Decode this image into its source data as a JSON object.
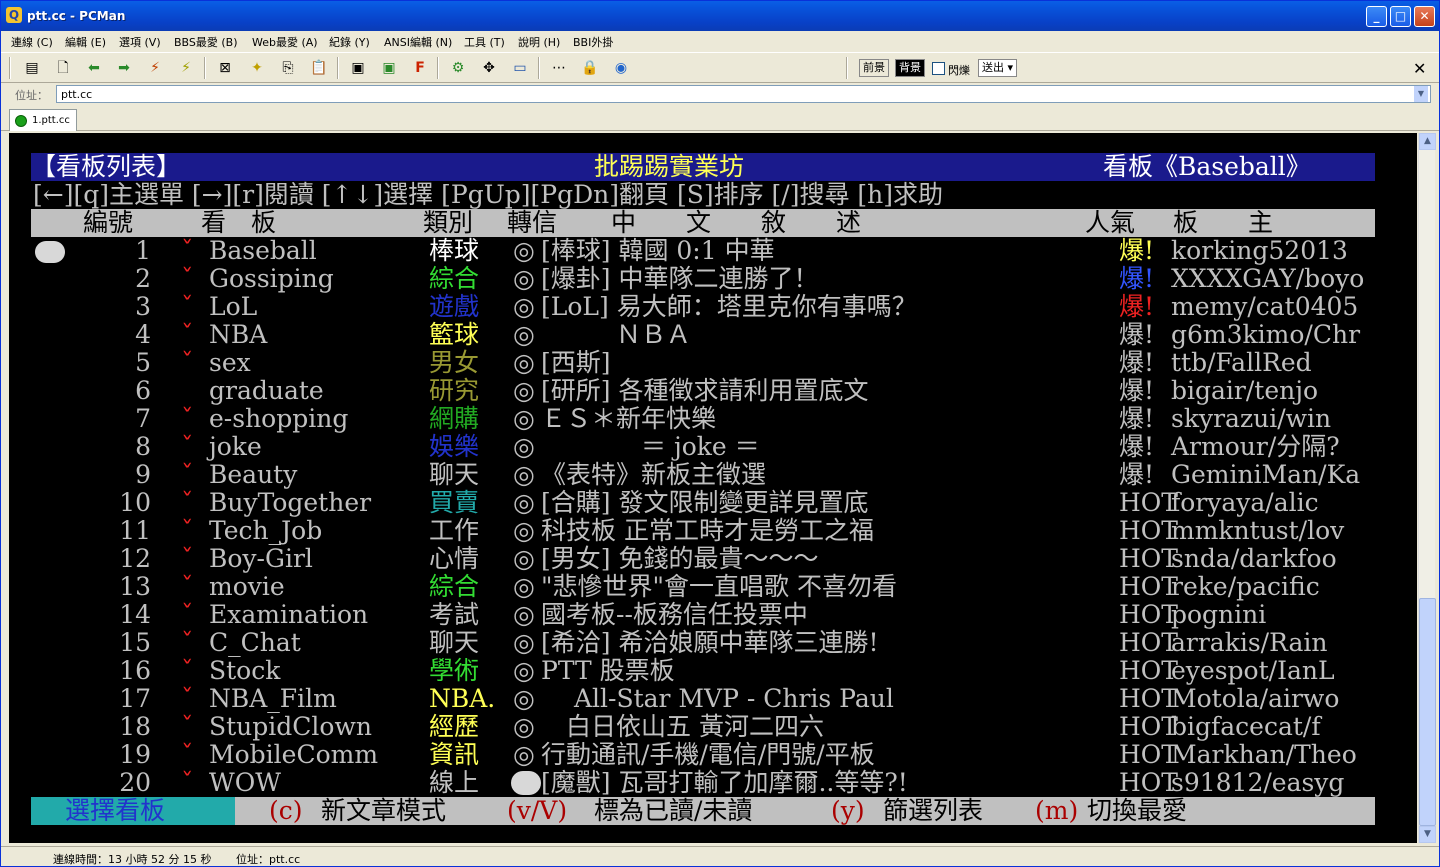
{
  "window": {
    "title": "ptt.cc - PCMan"
  },
  "menu": [
    "連線 (C)",
    "編輯 (E)",
    "選項 (V)",
    "BBS最愛 (B)",
    "Web最愛 (A)",
    "紀錄 (Y)",
    "ANSI編輯 (N)",
    "工具 (T)",
    "說明 (H)",
    "BBI外掛"
  ],
  "toolbar": {
    "fg_label": "前景",
    "bg_label": "背景",
    "blink_label": "閃爍",
    "send_label": "送出"
  },
  "address": {
    "label": "位址：",
    "value": "ptt.cc"
  },
  "tab": {
    "label": "1.ptt.cc"
  },
  "terminal": {
    "header": {
      "left": "【看板列表】",
      "center": "批踢踢實業坊",
      "right": "看板《Baseball》"
    },
    "help": "[←][q]主選單 [→][r]閱讀 [↑↓]選擇 [PgUp][PgDn]翻頁 [S]排序 [/]搜尋 [h]求助",
    "cols": {
      "num": "編號",
      "board": "看　板",
      "cat": "類別",
      "zhuan": "轉信",
      "desc": "中　　文　　敘　　述",
      "pop": "人氣",
      "mod": "板　　主"
    },
    "rows": [
      {
        "num": "1",
        "mark": "ˇ",
        "board": "Baseball",
        "cat": "棒球",
        "cat_color": "#ffffff",
        "zhuan": "◎",
        "desc": "[棒球] 韓國 0:1 中華",
        "pop": "爆!",
        "pop_color": "#ffff55",
        "mod": "korking52013",
        "cursor": true
      },
      {
        "num": "2",
        "mark": "ˇ",
        "board": "Gossiping",
        "cat": "綜合",
        "cat_color": "#33dd33",
        "zhuan": "◎",
        "desc": "[爆卦] 中華隊二連勝了！",
        "pop": "爆!",
        "pop_color": "#3355ff",
        "mod": "XXXXGAY/boyo"
      },
      {
        "num": "3",
        "mark": "ˇ",
        "board": "LoL",
        "cat": "遊戲",
        "cat_color": "#2233cc",
        "zhuan": "◎",
        "desc": "[LoL] 易大師：塔里克你有事嗎？",
        "pop": "爆!",
        "pop_color": "#ee2222",
        "mod": "memy/cat0405"
      },
      {
        "num": "4",
        "mark": "ˇ",
        "board": "NBA",
        "cat": "籃球",
        "cat_color": "#ffff55",
        "zhuan": "◎",
        "desc": "　　　ＮＢＡ",
        "pop": "爆!",
        "pop_color": "#c0c0c0",
        "mod": "g6m3kimo/Chr"
      },
      {
        "num": "5",
        "mark": "ˇ",
        "board": "sex",
        "cat": "男女",
        "cat_color": "#999933",
        "zhuan": "◎",
        "desc": "[西斯]",
        "pop": "爆!",
        "pop_color": "#c0c0c0",
        "mod": "ttb/FallRed"
      },
      {
        "num": "6",
        "mark": "",
        "board": "graduate",
        "cat": "研究",
        "cat_color": "#999933",
        "zhuan": "◎",
        "desc": "[研所] 各種徵求請利用置底文",
        "pop": "爆!",
        "pop_color": "#c0c0c0",
        "mod": "bigair/tenjo"
      },
      {
        "num": "7",
        "mark": "ˇ",
        "board": "e-shopping",
        "cat": "網購",
        "cat_color": "#22aa22",
        "zhuan": "◎",
        "desc": "ＥＳ＊新年快樂",
        "pop": "爆!",
        "pop_color": "#c0c0c0",
        "mod": "skyrazui/win"
      },
      {
        "num": "8",
        "mark": "ˇ",
        "board": "joke",
        "cat": "娛樂",
        "cat_color": "#2233cc",
        "zhuan": "◎",
        "desc": "　　　　＝ joke ＝",
        "pop": "爆!",
        "pop_color": "#c0c0c0",
        "mod": "Armour/分隔?"
      },
      {
        "num": "9",
        "mark": "ˇ",
        "board": "Beauty",
        "cat": "聊天",
        "cat_color": "#c0c0c0",
        "zhuan": "◎",
        "desc": "《表特》新板主徵選",
        "pop": "爆!",
        "pop_color": "#c0c0c0",
        "mod": "GeminiMan/Ka"
      },
      {
        "num": "10",
        "mark": "ˇ",
        "board": "BuyTogether",
        "cat": "買賣",
        "cat_color": "#22aaaa",
        "zhuan": "◎",
        "desc": "[合購] 發文限制變更詳見置底",
        "pop": "HOT",
        "pop_color": "#c0c0c0",
        "mod": "foryaya/alic"
      },
      {
        "num": "11",
        "mark": "ˇ",
        "board": "Tech_Job",
        "cat": "工作",
        "cat_color": "#c0c0c0",
        "zhuan": "◎",
        "desc": "科技板 正常工時才是勞工之福",
        "pop": "HOT",
        "pop_color": "#c0c0c0",
        "mod": "mmkntust/lov"
      },
      {
        "num": "12",
        "mark": "ˇ",
        "board": "Boy-Girl",
        "cat": "心情",
        "cat_color": "#c0c0c0",
        "zhuan": "◎",
        "desc": "[男女] 免錢的最貴～～～",
        "pop": "HOT",
        "pop_color": "#c0c0c0",
        "mod": "snda/darkfoo"
      },
      {
        "num": "13",
        "mark": "ˇ",
        "board": "movie",
        "cat": "綜合",
        "cat_color": "#33dd33",
        "zhuan": "◎",
        "desc": "\"悲慘世界\"會一直唱歌 不喜勿看",
        "pop": "HOT",
        "pop_color": "#c0c0c0",
        "mod": "reke/pacific"
      },
      {
        "num": "14",
        "mark": "ˇ",
        "board": "Examination",
        "cat": "考試",
        "cat_color": "#c0c0c0",
        "zhuan": "◎",
        "desc": "國考板--板務信任投票中",
        "pop": "HOT",
        "pop_color": "#c0c0c0",
        "mod": "pognini"
      },
      {
        "num": "15",
        "mark": "ˇ",
        "board": "C_Chat",
        "cat": "聊天",
        "cat_color": "#c0c0c0",
        "zhuan": "◎",
        "desc": "[希洽] 希洽娘願中華隊三連勝!",
        "pop": "HOT",
        "pop_color": "#c0c0c0",
        "mod": "arrakis/Rain"
      },
      {
        "num": "16",
        "mark": "ˇ",
        "board": "Stock",
        "cat": "學術",
        "cat_color": "#33dd33",
        "zhuan": "◎",
        "desc": "PTT 股票板",
        "pop": "HOT",
        "pop_color": "#c0c0c0",
        "mod": "eyespot/IanL"
      },
      {
        "num": "17",
        "mark": "ˇ",
        "board": "NBA_Film",
        "cat": "NBA.",
        "cat_color": "#ffff55",
        "zhuan": "◎",
        "desc": "　 All-Star MVP - Chris Paul",
        "pop": "HOT",
        "pop_color": "#c0c0c0",
        "mod": "Motola/airwo"
      },
      {
        "num": "18",
        "mark": "ˇ",
        "board": "StupidClown",
        "cat": "經歷",
        "cat_color": "#ffff55",
        "zhuan": "◎",
        "desc": "　白日依山五 黃河二四六",
        "pop": "HOT",
        "pop_color": "#c0c0c0",
        "mod": "bigfacecat/f"
      },
      {
        "num": "19",
        "mark": "ˇ",
        "board": "MobileComm",
        "cat": "資訊",
        "cat_color": "#ffff55",
        "zhuan": "◎",
        "desc": "行動通訊/手機/電信/門號/平板",
        "pop": "HOT",
        "pop_color": "#c0c0c0",
        "mod": "Markhan/Theo"
      },
      {
        "num": "20",
        "mark": "ˇ",
        "board": "WOW",
        "cat": "線上",
        "cat_color": "#c0c0c0",
        "zhuan": "",
        "desc": "[魔獸] 瓦哥打輸了加摩爾..等等?!",
        "pop": "HOT",
        "pop_color": "#c0c0c0",
        "mod": "s91812/easyg",
        "caret": true
      }
    ],
    "footer": {
      "mode": "選擇看板",
      "items": [
        {
          "key": "(c)",
          "label": "新文章模式"
        },
        {
          "key": "(v/V)",
          "label": "標為已讀/未讀"
        },
        {
          "key": "(y)",
          "label": "篩選列表"
        },
        {
          "key": "(m)",
          "label": "切換最愛"
        }
      ]
    }
  },
  "status": {
    "time": "連線時間：13 小時 52 分 15 秒",
    "addr": "位址：ptt.cc"
  }
}
